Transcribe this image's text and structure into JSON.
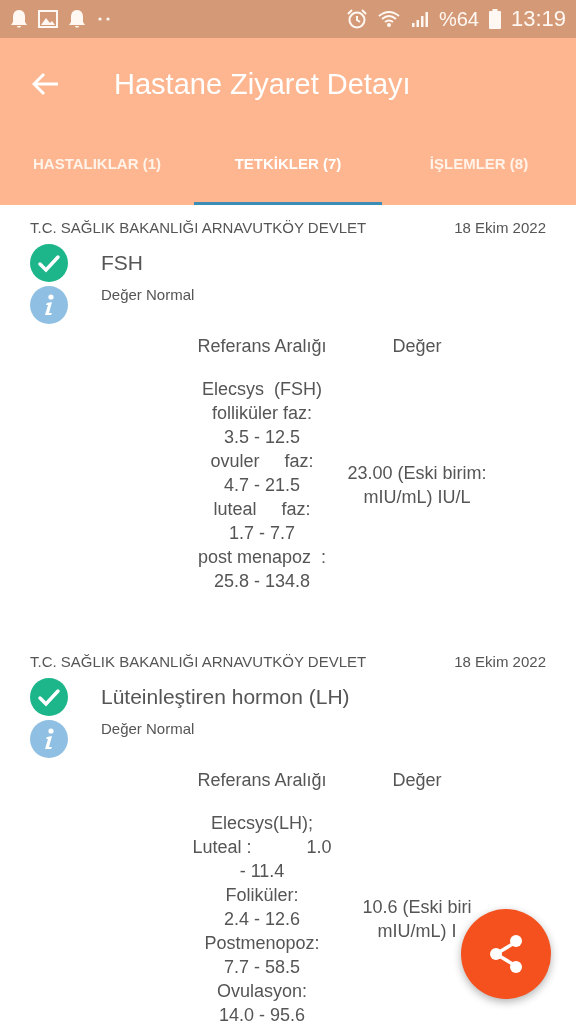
{
  "status_bar": {
    "battery_text": "%64",
    "time": "13:19"
  },
  "app_bar": {
    "title": "Hastane Ziyaret Detayı"
  },
  "tabs": [
    {
      "label": "HASTALIKLAR (1)",
      "selected": false
    },
    {
      "label": "TETKİKLER (7)",
      "selected": true
    },
    {
      "label": "İŞLEMLER (8)",
      "selected": false
    }
  ],
  "tests": [
    {
      "hospital": "T.C. SAĞLIK BAKANLIĞI ARNAVUTKÖY DEVLET",
      "date": "18 Ekim 2022",
      "name": "FSH",
      "status": "Değer Normal",
      "reference_header": "Referans Aralığı",
      "value_header": "Değer",
      "reference_lines": [
        "Elecsys  (FSH)",
        "folliküler faz:",
        "3.5 - 12.5",
        "ovuler     faz:",
        "4.7 - 21.5",
        "luteal     faz:",
        "1.7 - 7.7",
        "post menapoz  :",
        "25.8 - 134.8"
      ],
      "value_lines": [
        "23.00 (Eski birim:",
        "mIU/mL) IU/L"
      ]
    },
    {
      "hospital": "T.C. SAĞLIK BAKANLIĞI ARNAVUTKÖY DEVLET",
      "date": "18 Ekim 2022",
      "name": "Lüteinleştiren hormon (LH)",
      "status": "Değer Normal",
      "reference_header": "Referans Aralığı",
      "value_header": "Değer",
      "reference_lines": [
        "Elecsys(LH);",
        "Luteal :           1.0",
        "- 11.4",
        "Foliküler:",
        "2.4 - 12.6",
        "Postmenopoz:",
        "7.7 - 58.5",
        "Ovulasyon:",
        "14.0 - 95.6"
      ],
      "value_lines": [
        "10.6 (Eski biri",
        "mIU/mL) I"
      ]
    }
  ]
}
